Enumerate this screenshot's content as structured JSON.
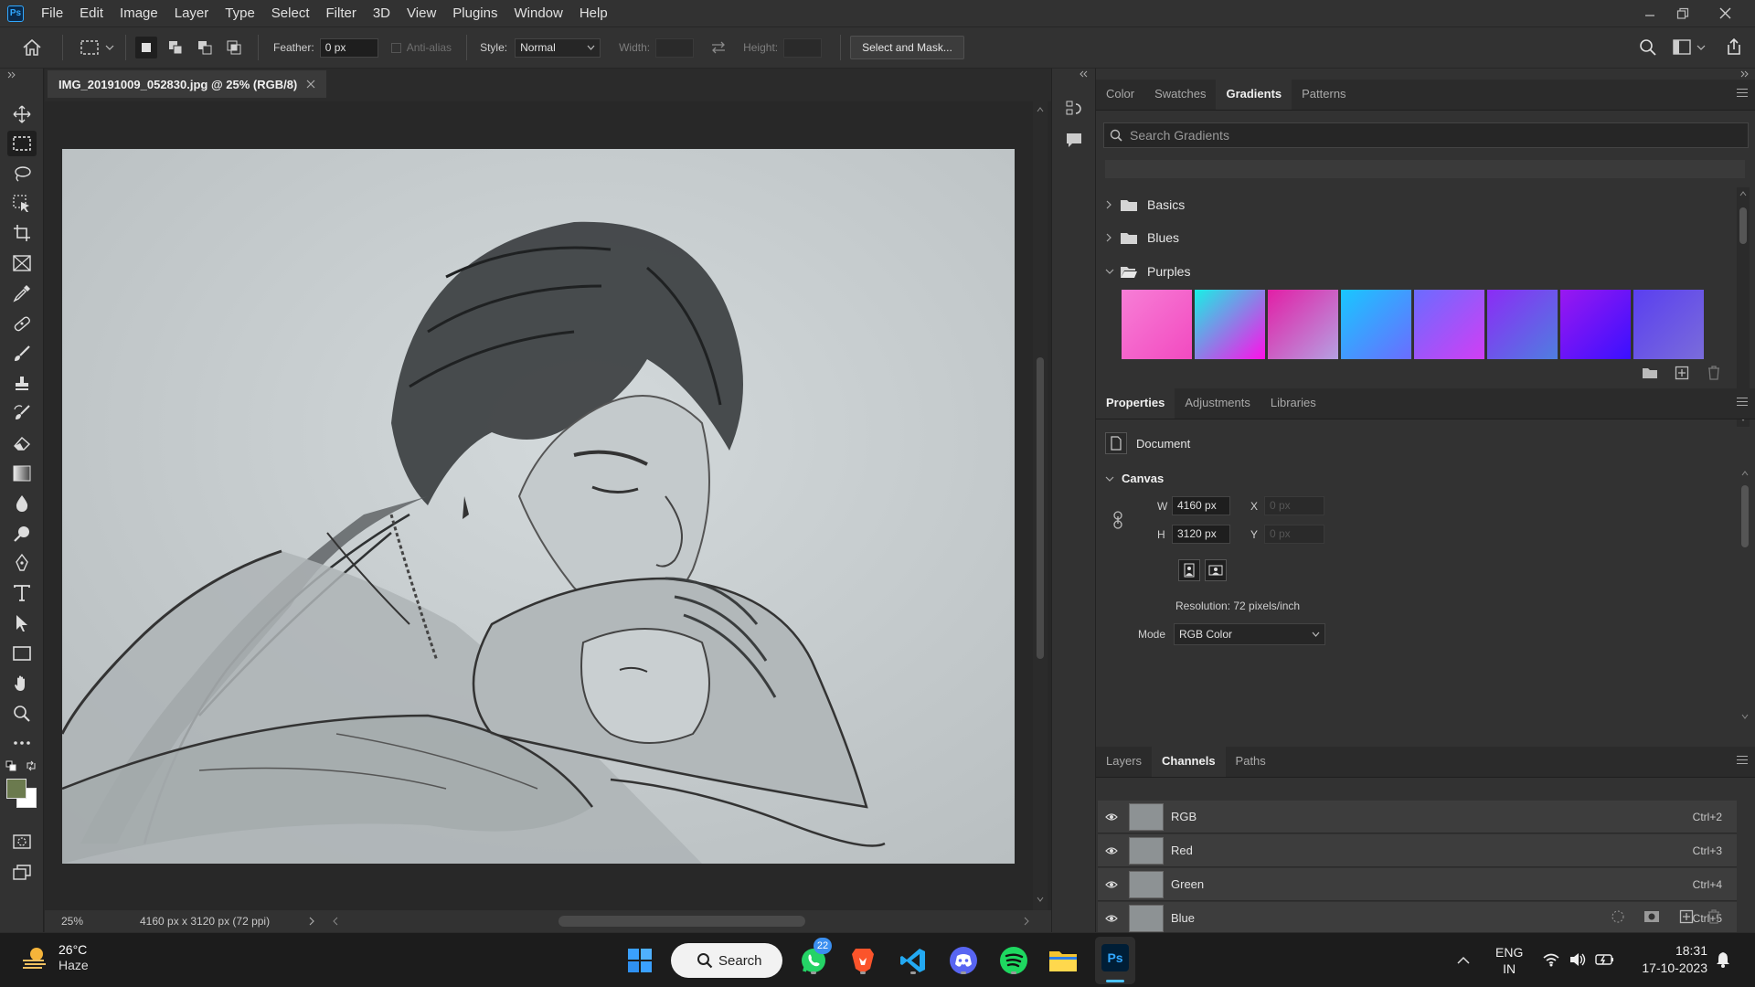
{
  "app": {
    "logo_text": "Ps",
    "menu": [
      "File",
      "Edit",
      "Image",
      "Layer",
      "Type",
      "Select",
      "Filter",
      "3D",
      "View",
      "Plugins",
      "Window",
      "Help"
    ]
  },
  "options": {
    "feather_label": "Feather:",
    "feather_value": "0 px",
    "antialias_label": "Anti-alias",
    "style_label": "Style:",
    "style_value": "Normal",
    "width_label": "Width:",
    "height_label": "Height:",
    "select_mask_label": "Select and Mask..."
  },
  "document": {
    "tab_title": "IMG_20191009_052830.jpg @ 25% (RGB/8)",
    "zoom": "25%",
    "doc_info": "4160 px x 3120 px (72 ppi)"
  },
  "gradients_panel": {
    "tabs": [
      "Color",
      "Swatches",
      "Gradients",
      "Patterns"
    ],
    "active_tab": "Gradients",
    "search_placeholder": "Search Gradients",
    "folders": [
      "Basics",
      "Blues",
      "Purples"
    ],
    "swatches": [
      [
        "#f77ed6",
        "#f24ac0"
      ],
      [
        "#18f0e6",
        "#ff10e8"
      ],
      [
        "#e21fa6",
        "#b5a0e2"
      ],
      [
        "#18c7ff",
        "#6b6cff"
      ],
      [
        "#6a6cff",
        "#d13ef4"
      ],
      [
        "#8b2cf5",
        "#4f7ee0"
      ],
      [
        "#9a18f0",
        "#3a10ff"
      ],
      [
        "#5a3ff0",
        "#7a6cda"
      ]
    ]
  },
  "properties_panel": {
    "tabs": [
      "Properties",
      "Adjustments",
      "Libraries"
    ],
    "active_tab": "Properties",
    "doc_label": "Document",
    "canvas_label": "Canvas",
    "w_label": "W",
    "w_value": "4160 px",
    "h_label": "H",
    "h_value": "3120 px",
    "x_label": "X",
    "x_placeholder": "0 px",
    "y_label": "Y",
    "y_placeholder": "0 px",
    "resolution": "Resolution: 72 pixels/inch",
    "mode_label": "Mode",
    "mode_value": "RGB Color"
  },
  "channels_panel": {
    "tabs": [
      "Layers",
      "Channels",
      "Paths"
    ],
    "active_tab": "Channels",
    "channels": [
      {
        "name": "RGB",
        "shortcut": "Ctrl+2"
      },
      {
        "name": "Red",
        "shortcut": "Ctrl+3"
      },
      {
        "name": "Green",
        "shortcut": "Ctrl+4"
      },
      {
        "name": "Blue",
        "shortcut": "Ctrl+5"
      }
    ]
  },
  "taskbar": {
    "weather_temp": "26°C",
    "weather_desc": "Haze",
    "search_label": "Search",
    "whatsapp_badge": "22",
    "lang": "ENG",
    "region": "IN",
    "time": "18:31",
    "date": "17-10-2023"
  },
  "colors": {
    "foreground": "#6b7a4e",
    "background": "#ffffff",
    "accent": "#31a8ff"
  }
}
